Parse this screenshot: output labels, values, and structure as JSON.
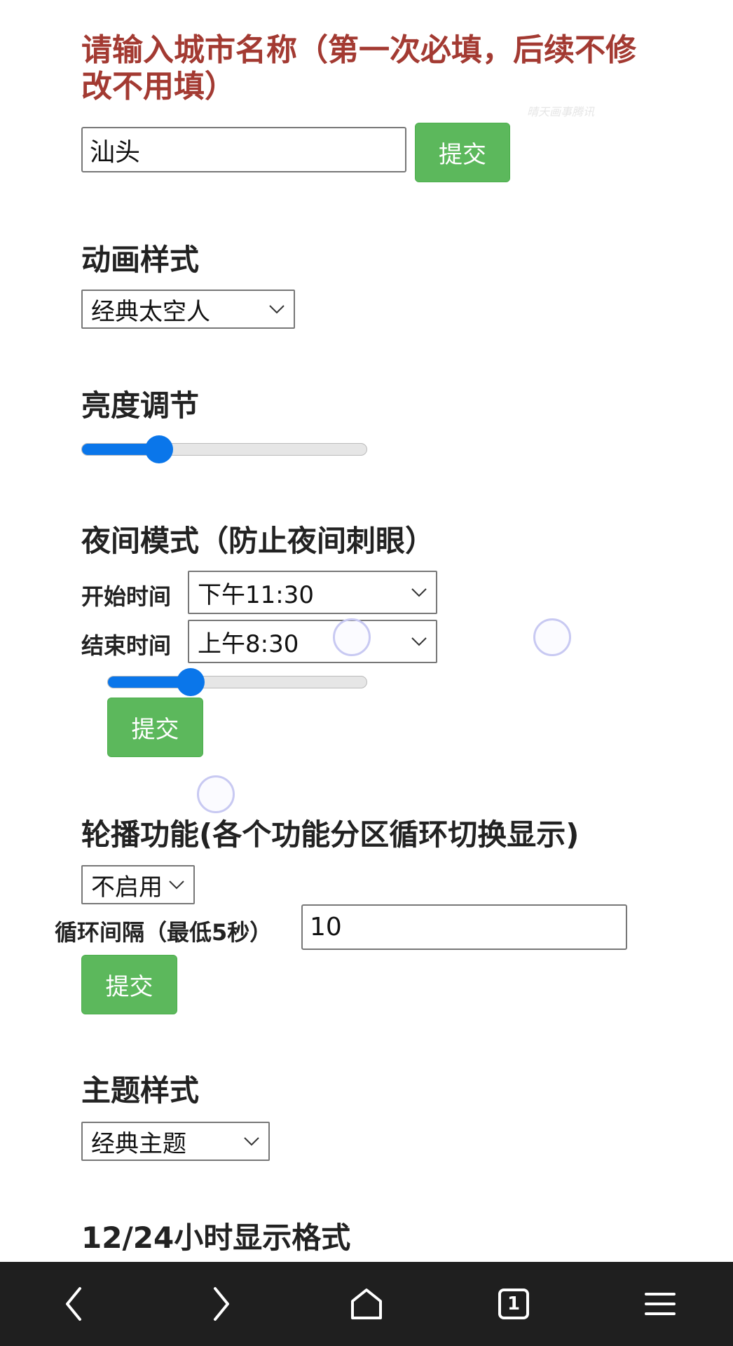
{
  "city": {
    "title": "请输入城市名称（第一次必填，后续不修改不用填）",
    "watermark": "晴天画事腾讯",
    "input_value": "汕头",
    "submit_label": "提交"
  },
  "animation": {
    "title": "动画样式",
    "selected": "经典太空人"
  },
  "brightness": {
    "title": "亮度调节",
    "value_fraction": 0.27
  },
  "night_mode": {
    "title": "夜间模式（防止夜间刺眼）",
    "start_label": "开始时间",
    "start_value": "下午11:30",
    "end_label": "结束时间",
    "end_value": "上午8:30",
    "slider_fraction": 0.32,
    "submit_label": "提交"
  },
  "carousel": {
    "title": "轮播功能(各个功能分区循环切换显示)",
    "selected": "不启用",
    "interval_label": "循环间隔（最低5秒）",
    "interval_value": "10",
    "submit_label": "提交"
  },
  "theme": {
    "title": "主题样式",
    "selected": "经典主题"
  },
  "time_format": {
    "title": "12/24小时显示格式"
  },
  "navbar": {
    "tab_count": "1",
    "icons": [
      "back-icon",
      "forward-icon",
      "home-icon",
      "tabs-icon",
      "menu-icon"
    ]
  },
  "colors": {
    "accent_blue": "#0a76ea",
    "button_green": "#5cb85c",
    "title_red": "#a33a32",
    "navbar_bg": "#1f1f1f"
  }
}
